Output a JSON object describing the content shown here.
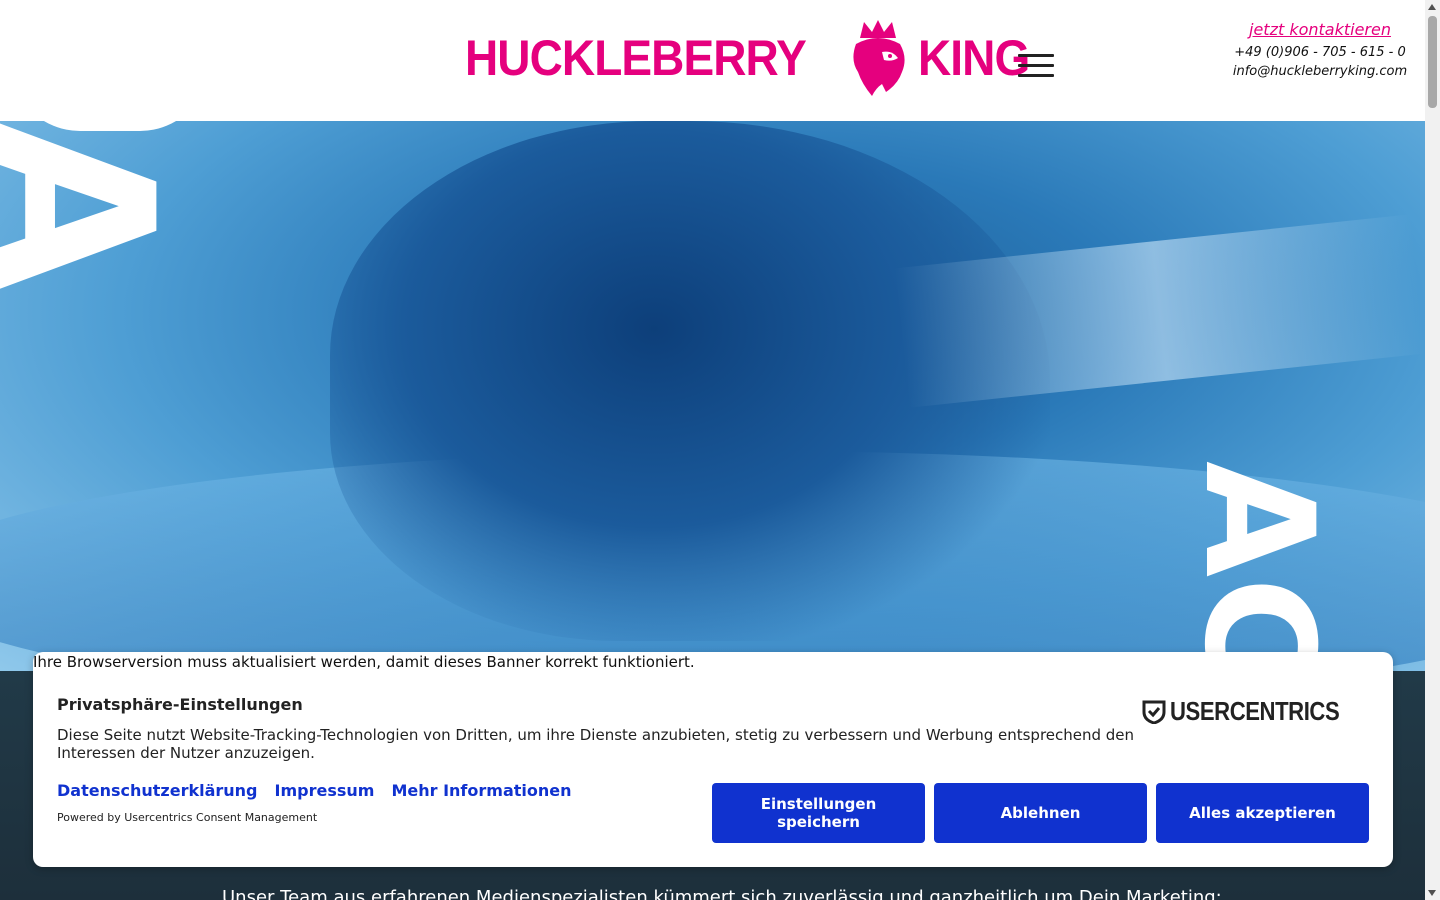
{
  "header": {
    "logo_left": "HUCKLEBERRY",
    "logo_right": "KING",
    "contact_cta": "jetzt kontaktieren",
    "phone": "+49 (0)906 - 705 - 615 - 0",
    "email": "info@huckleberryking.com",
    "menu_icon": "hamburger-menu-icon",
    "brand_color": "#e5007e"
  },
  "hero": {
    "left_letter": "A",
    "right_letters": "AC"
  },
  "section": {
    "intro_text": "Unser Team aus erfahrenen Medienspezialisten kümmert sich zuverlässig und ganzheitlich um Dein Marketing:"
  },
  "consent": {
    "browser_warning": "Ihre Browserversion muss aktualisiert werden, damit dieses Banner korrekt funktioniert.",
    "title": "Privatsphäre-Einstellungen",
    "description": "Diese Seite nutzt Website-Tracking-Technologien von Dritten, um ihre Dienste anzubieten, stetig zu verbessern und Werbung entsprechend den Interessen der Nutzer anzuzeigen.",
    "links": [
      "Datenschutzerklärung",
      "Impressum",
      "Mehr Informationen"
    ],
    "powered_by": "Powered by Usercentrics Consent Management",
    "brand": "USERCENTRICS",
    "buttons": {
      "settings": "Einstellungen speichern",
      "deny": "Ablehnen",
      "accept": "Alles akzeptieren"
    },
    "button_color": "#1032cf"
  }
}
